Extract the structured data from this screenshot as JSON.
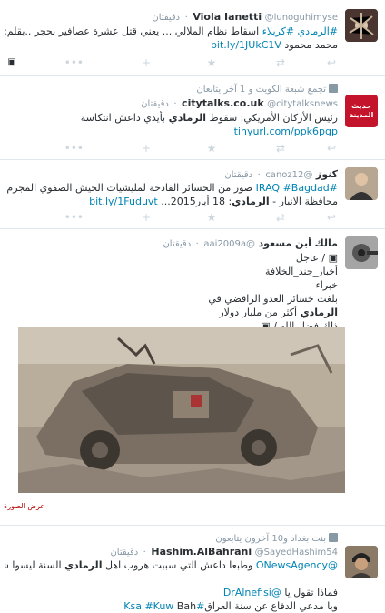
{
  "tweets": [
    {
      "name": "Viola Ianetti",
      "handle": "@lunoguhimyse",
      "time": "دقيقتان",
      "lines": [
        [
          {
            "t": "#الرمادي",
            "c": "hl"
          },
          {
            "t": " "
          },
          {
            "t": "#كربلاء",
            "c": "hl"
          },
          {
            "t": " اسقاط نظام الملالي ... يعني قتل عشرة عصافير بحجر ..بقلم: د."
          }
        ],
        [
          {
            "t": "محمد محمود "
          },
          {
            "t": "bit.ly/1JUkC1V",
            "c": "link"
          }
        ]
      ]
    },
    {
      "context": "تجمع شبعة الكويت و 1 آخر يتابعان",
      "name": "citytalks.co.uk",
      "handle": "@citytalksnews",
      "time": "دقيقتان",
      "avatar_text": "حديث المدينة",
      "lines": [
        [
          {
            "t": "رئيس الأركان الأمريكي: سقوط "
          },
          {
            "t": "الرمادي",
            "c": "b"
          },
          {
            "t": " بأيدي داعش انتكاسة"
          }
        ],
        [
          {
            "t": "tinyurl.com/ppk6pgp",
            "c": "link"
          }
        ]
      ]
    },
    {
      "name": "كنوز",
      "handle": "@canoz12",
      "time": "دقيقتان",
      "lines": [
        [
          {
            "t": "#IRAQ",
            "c": "hl"
          },
          {
            "t": " "
          },
          {
            "t": "#Bagdad",
            "c": "hl"
          },
          {
            "t": " صور من الخسائر الفادحة لمليشيات الجيش الصفوي المجرم في"
          }
        ],
        [
          {
            "t": "محافظة الانبار - "
          },
          {
            "t": "الرمادي",
            "c": "b"
          },
          {
            "t": ": 18 أيار2015... "
          },
          {
            "t": "bit.ly/1Fuduvt",
            "c": "link"
          }
        ]
      ]
    },
    {
      "name": "مالك أبن مسعود",
      "handle": "@aai2009a",
      "time": "دقيقتان",
      "lines": [
        [
          {
            "t": "▣ / عاجل"
          }
        ],
        [
          {
            "t": "أخبار_جند_الخلافة"
          }
        ],
        [
          {
            "t": "خبراء"
          }
        ],
        [
          {
            "t": "بلغت خسائر العدو الرافضي في"
          }
        ],
        [
          {
            "t": "الرمادي",
            "c": "b"
          },
          {
            "t": " أكثر من مليار دولار"
          }
        ],
        [
          {
            "t": "ذلك فضل الله / ▣"
          }
        ]
      ],
      "view_photo": "عرض الصورة"
    },
    {
      "context": "بنت بغداد و10 آخرون يتابعون",
      "name": "Hashim.AlBahrani",
      "handle": "@SayedHashim54",
      "time": "دقيقتان",
      "lines": [
        [
          {
            "t": "@ONewsAgency",
            "c": "link"
          },
          {
            "t": " وطبعا داعش التي سببت هروب اهل "
          },
          {
            "t": "الرمادي",
            "c": "b"
          },
          {
            "t": " السنة ليسوا شيعة"
          }
        ],
        [
          {
            "t": ""
          }
        ],
        [
          {
            "t": "فماذا تقول يا "
          },
          {
            "t": "@DrAlnefisi",
            "c": "link"
          }
        ],
        [
          {
            "t": "ويا مدعي الدفاع عن سنة العراق"
          },
          {
            "t": "#Ksa",
            "c": "hl"
          },
          {
            "t": " "
          },
          {
            "t": "#Kuw",
            "c": "hl"
          },
          {
            "t": " Bah"
          }
        ]
      ]
    }
  ]
}
